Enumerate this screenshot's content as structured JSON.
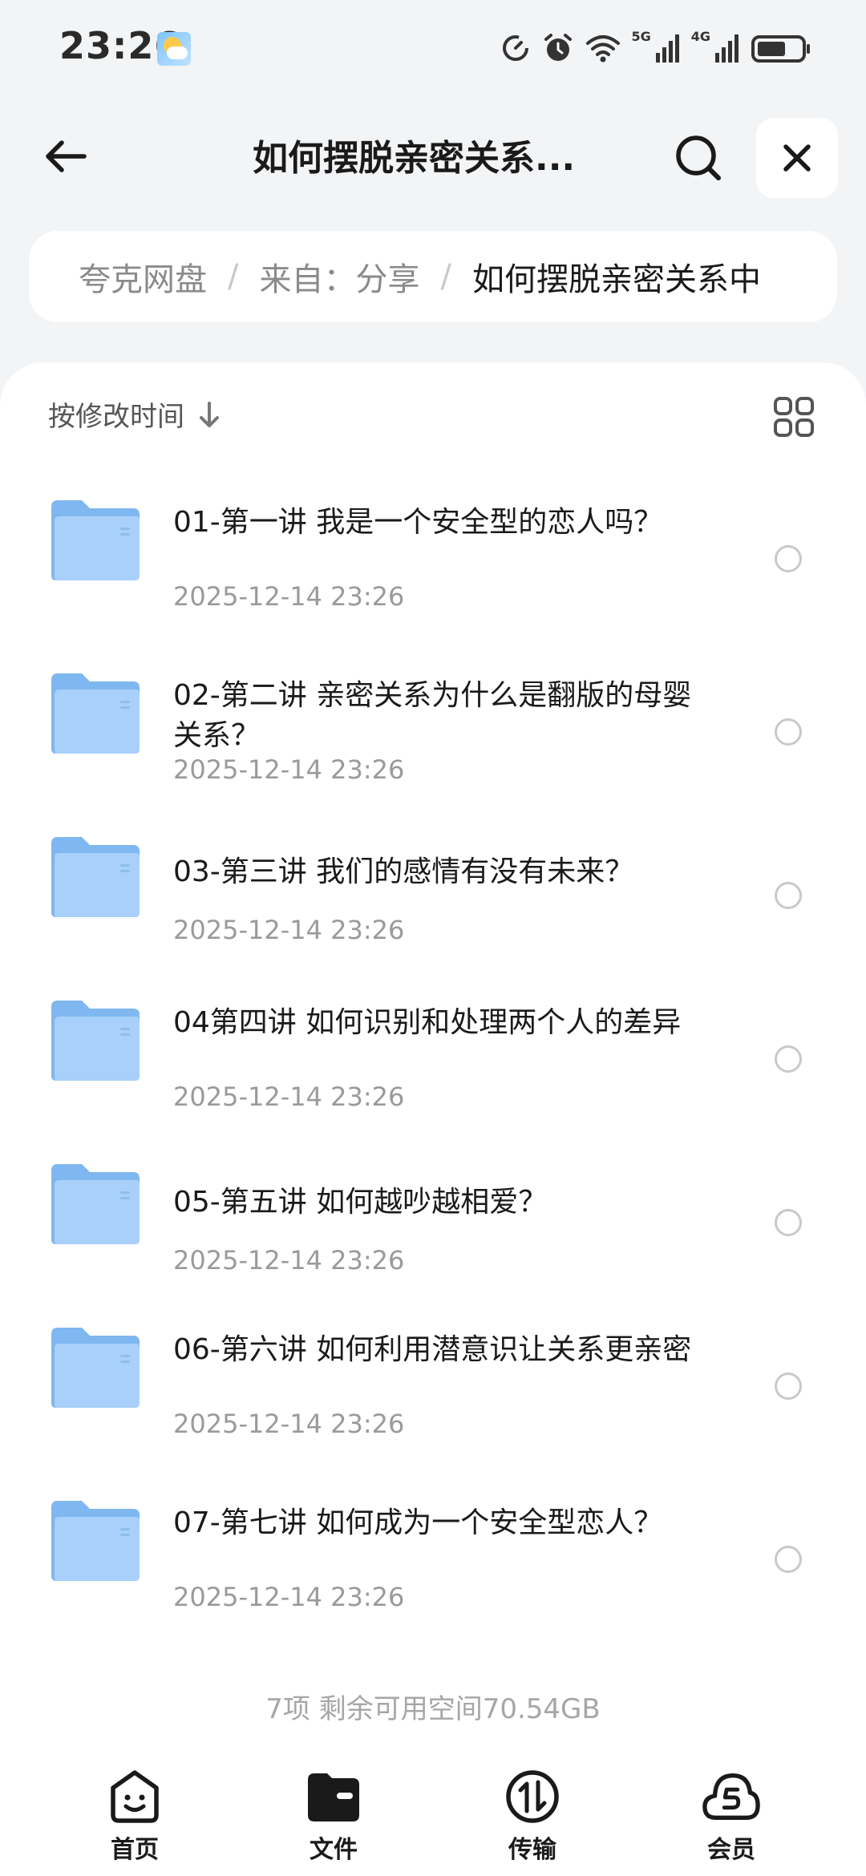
{
  "status_bar": {
    "time": "23:26",
    "network_labels": [
      "5G",
      "4G"
    ],
    "icons": [
      "weather-icon",
      "data-saver-icon",
      "alarm-icon",
      "wifi-icon",
      "signal-5g-icon",
      "signal-4g-icon",
      "battery-icon"
    ],
    "battery_level": 0.65
  },
  "header": {
    "title": "如何摆脱亲密关系...",
    "back_icon": "back-arrow-icon",
    "search_icon": "search-icon",
    "close_icon": "close-icon"
  },
  "breadcrumb": {
    "items": [
      "夸克网盘",
      "来自：分享",
      "如何摆脱亲密关系中"
    ],
    "separator": "/"
  },
  "toolbar": {
    "sort_label": "按修改时间",
    "sort_icon": "arrow-down-icon",
    "view_icon": "grid-view-icon"
  },
  "files": [
    {
      "name": "01-第一讲  我是一个安全型的恋人吗？",
      "date": "2025-12-14 23:26"
    },
    {
      "name": "02-第二讲 亲密关系为什么是翻版的母婴关系？",
      "date": "2025-12-14 23:26"
    },
    {
      "name": "03-第三讲 我们的感情有没有未来？",
      "date": "2025-12-14 23:26"
    },
    {
      "name": "04第四讲  如何识别和处理两个人的差异",
      "date": "2025-12-14 23:26"
    },
    {
      "name": "05-第五讲  如何越吵越相爱？",
      "date": "2025-12-14 23:26"
    },
    {
      "name": "06-第六讲  如何利用潜意识让关系更亲密",
      "date": "2025-12-14 23:26"
    },
    {
      "name": "07-第七讲  如何成为一个安全型恋人？",
      "date": "2025-12-14 23:26"
    }
  ],
  "footer": {
    "summary": "7项 剩余可用空间70.54GB"
  },
  "bottom_nav": [
    {
      "label": "首页",
      "icon": "home-face-icon"
    },
    {
      "label": "文件",
      "icon": "folder-wallet-icon"
    },
    {
      "label": "传输",
      "icon": "transfer-icon"
    },
    {
      "label": "会员",
      "icon": "member-cloud-icon"
    }
  ],
  "colors": {
    "background": "#f3f4f6",
    "card": "#ffffff",
    "folder": "#7fb7f0",
    "folder_light": "#a9d0fa",
    "muted_text": "#9a9a9a",
    "primary_text": "#1a1a1a"
  }
}
